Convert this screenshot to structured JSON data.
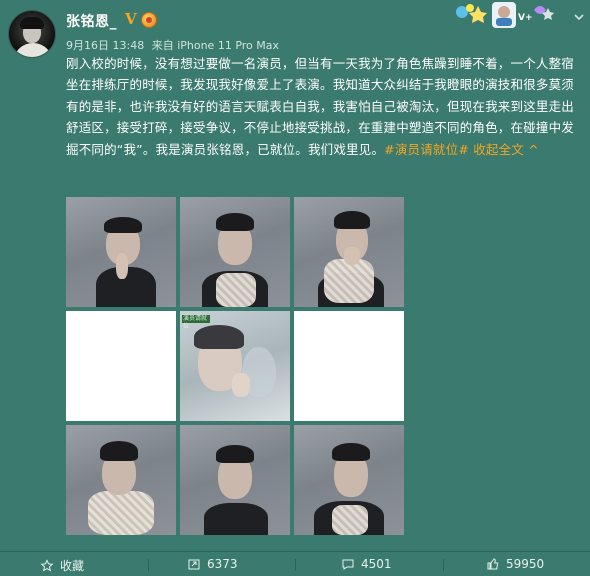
{
  "user": {
    "name": "张铭恩_",
    "verified_badge": "V",
    "meta_date": "9月16日 13:48",
    "meta_source": "来自 iPhone 11 Pro Max"
  },
  "post": {
    "text": "刚入校的时候，没有想过要做一名演员，但当有一天我为了角色焦躁到睡不着，一个人整宿坐在排练厅的时候，我发现我好像爱上了表演。我知道大众纠结于我瞪眼的演技和很多莫须有的是非，也许我没有好的语言天赋表白自我，我害怕自己被淘汰，但现在我来到这里走出舒适区，接受打碎，接受争议，不停止地接受挑战，在重建中塑造不同的角色，在碰撞中发掘不同的“我”。我是演员张铭恩，已就位。我们戏里见。",
    "hashtag": "#演员请就位#",
    "collapse_label": "收起全文",
    "collapse_arrow": "^",
    "center_tile_tag": "演员请就位"
  },
  "actions": {
    "favorite_label": "收藏",
    "repost_count": "6373",
    "comment_count": "4501",
    "like_count": "59950"
  },
  "colors": {
    "background": "#3b7a6e",
    "accent": "#f5a623",
    "text": "#ffffff"
  },
  "icons": [
    "avatar",
    "verified-icon",
    "medal-icon",
    "decor-banner",
    "chevron-down-icon",
    "star-icon",
    "repost-icon",
    "comment-icon",
    "like-icon"
  ]
}
